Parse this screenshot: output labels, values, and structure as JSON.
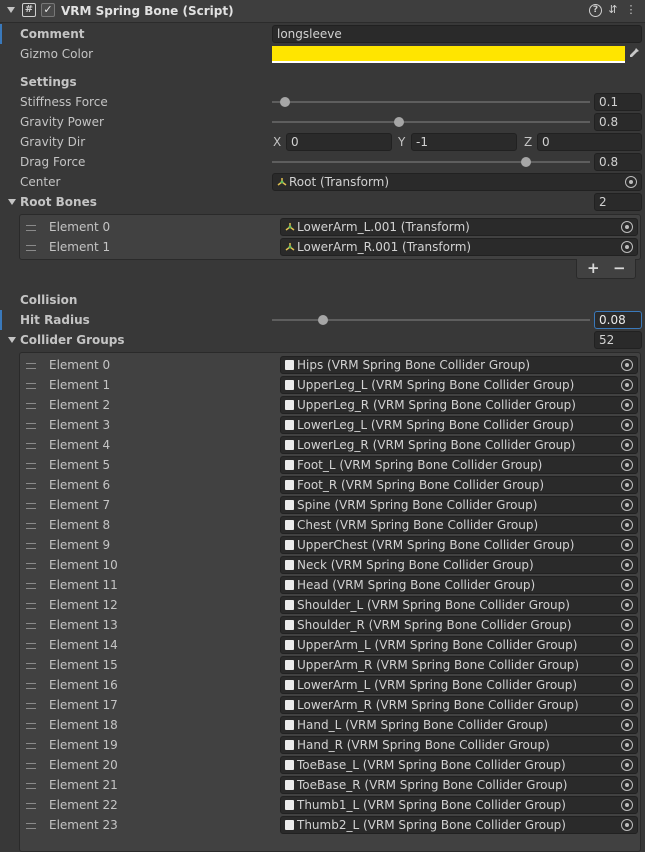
{
  "header": {
    "title": "VRM Spring Bone (Script)",
    "enabled_check": "✓",
    "script_glyph": "#",
    "help_glyph": "?",
    "preset_glyph": "⇵",
    "menu_glyph": "⋮"
  },
  "comment": {
    "label": "Comment",
    "value": "longsleeve"
  },
  "gizmo": {
    "label": "Gizmo Color",
    "color": "#ffe500"
  },
  "settings": {
    "heading": "Settings",
    "stiffness": {
      "label": "Stiffness Force",
      "value": "0.1",
      "fraction": 0.04
    },
    "gravity_power": {
      "label": "Gravity Power",
      "value": "0.8",
      "fraction": 0.4
    },
    "gravity_dir": {
      "label": "Gravity Dir",
      "x_label": "X",
      "x": "0",
      "y_label": "Y",
      "y": "-1",
      "z_label": "Z",
      "z": "0"
    },
    "drag": {
      "label": "Drag Force",
      "value": "0.8",
      "fraction": 0.8
    },
    "center": {
      "label": "Center",
      "value": "Root (Transform)"
    }
  },
  "root_bones": {
    "label": "Root Bones",
    "count": "2",
    "items": [
      {
        "label": "Element 0",
        "value": "LowerArm_L.001 (Transform)"
      },
      {
        "label": "Element 1",
        "value": "LowerArm_R.001 (Transform)"
      }
    ],
    "add": "+",
    "remove": "−"
  },
  "collision": {
    "heading": "Collision",
    "hit_radius": {
      "label": "Hit Radius",
      "value": "0.08",
      "fraction": 0.16
    }
  },
  "collider_groups": {
    "label": "Collider Groups",
    "count": "52",
    "items": [
      {
        "label": "Element 0",
        "value": "Hips (VRM Spring Bone Collider Group)"
      },
      {
        "label": "Element 1",
        "value": "UpperLeg_L (VRM Spring Bone Collider Group)"
      },
      {
        "label": "Element 2",
        "value": "UpperLeg_R (VRM Spring Bone Collider Group)"
      },
      {
        "label": "Element 3",
        "value": "LowerLeg_L (VRM Spring Bone Collider Group)"
      },
      {
        "label": "Element 4",
        "value": "LowerLeg_R (VRM Spring Bone Collider Group)"
      },
      {
        "label": "Element 5",
        "value": "Foot_L (VRM Spring Bone Collider Group)"
      },
      {
        "label": "Element 6",
        "value": "Foot_R (VRM Spring Bone Collider Group)"
      },
      {
        "label": "Element 7",
        "value": "Spine (VRM Spring Bone Collider Group)"
      },
      {
        "label": "Element 8",
        "value": "Chest (VRM Spring Bone Collider Group)"
      },
      {
        "label": "Element 9",
        "value": "UpperChest (VRM Spring Bone Collider Group)"
      },
      {
        "label": "Element 10",
        "value": "Neck (VRM Spring Bone Collider Group)"
      },
      {
        "label": "Element 11",
        "value": "Head (VRM Spring Bone Collider Group)"
      },
      {
        "label": "Element 12",
        "value": "Shoulder_L (VRM Spring Bone Collider Group)"
      },
      {
        "label": "Element 13",
        "value": "Shoulder_R (VRM Spring Bone Collider Group)"
      },
      {
        "label": "Element 14",
        "value": "UpperArm_L (VRM Spring Bone Collider Group)"
      },
      {
        "label": "Element 15",
        "value": "UpperArm_R (VRM Spring Bone Collider Group)"
      },
      {
        "label": "Element 16",
        "value": "LowerArm_L (VRM Spring Bone Collider Group)"
      },
      {
        "label": "Element 17",
        "value": "LowerArm_R (VRM Spring Bone Collider Group)"
      },
      {
        "label": "Element 18",
        "value": "Hand_L (VRM Spring Bone Collider Group)"
      },
      {
        "label": "Element 19",
        "value": "Hand_R (VRM Spring Bone Collider Group)"
      },
      {
        "label": "Element 20",
        "value": "ToeBase_L (VRM Spring Bone Collider Group)"
      },
      {
        "label": "Element 21",
        "value": "ToeBase_R (VRM Spring Bone Collider Group)"
      },
      {
        "label": "Element 22",
        "value": "Thumb1_L (VRM Spring Bone Collider Group)"
      },
      {
        "label": "Element 23",
        "value": "Thumb2_L (VRM Spring Bone Collider Group)"
      }
    ]
  }
}
